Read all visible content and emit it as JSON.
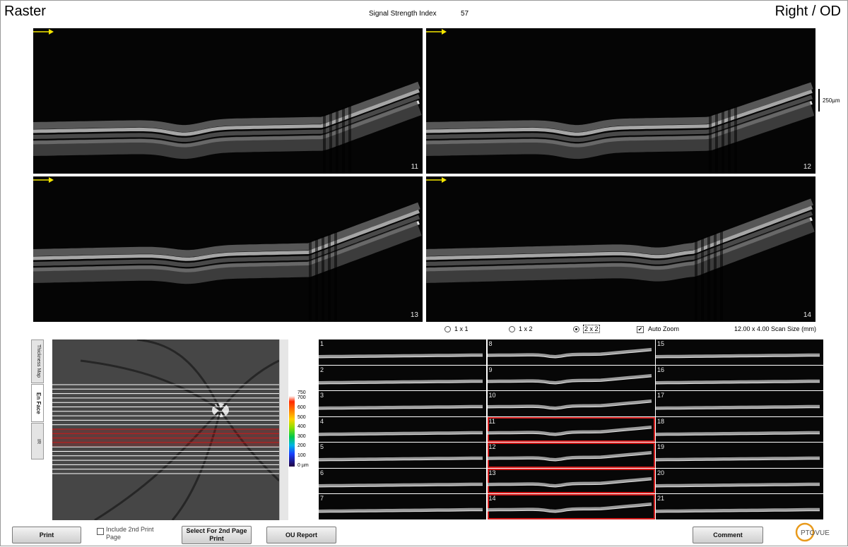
{
  "header": {
    "title_left": "Raster",
    "title_right": "Right / OD",
    "signal_strength_label": "Signal Strength Index",
    "signal_strength_value": "57"
  },
  "main_scans": [
    {
      "number": "11"
    },
    {
      "number": "12"
    },
    {
      "number": "13"
    },
    {
      "number": "14"
    }
  ],
  "scale_bar": {
    "label": "250µm"
  },
  "view_options": {
    "opt_1x1": "1 x 1",
    "opt_1x2": "1 x 2",
    "opt_2x2": "2 x 2",
    "selected": "2 x 2",
    "auto_zoom_label": "Auto Zoom",
    "auto_zoom_checked": true,
    "scan_size": "12.00 x 4.00 Scan Size (mm)"
  },
  "side_tabs": {
    "thickness_map": "Thickness Map",
    "en_face": "En Face",
    "ir": "IR",
    "active": "En Face"
  },
  "color_scale": {
    "labels": [
      "750",
      "700",
      "600",
      "500",
      "400",
      "300",
      "200",
      "100",
      "0 µm"
    ]
  },
  "thumbnails": {
    "numbers": [
      "1",
      "2",
      "3",
      "4",
      "5",
      "6",
      "7",
      "8",
      "9",
      "10",
      "11",
      "12",
      "13",
      "14",
      "15",
      "16",
      "17",
      "18",
      "19",
      "20",
      "21"
    ],
    "selected": [
      "11",
      "12",
      "13",
      "14"
    ]
  },
  "footer": {
    "print": "Print",
    "include_2nd_print_page": "Include 2nd Print Page",
    "select_for_2nd_page_print": "Select For 2nd Page Print",
    "ou_report": "OU Report",
    "comment": "Comment",
    "logo_text": "OPTOVUE"
  },
  "colors": {
    "selection_red": "#d01818",
    "arrow_yellow": "#f4e600"
  }
}
